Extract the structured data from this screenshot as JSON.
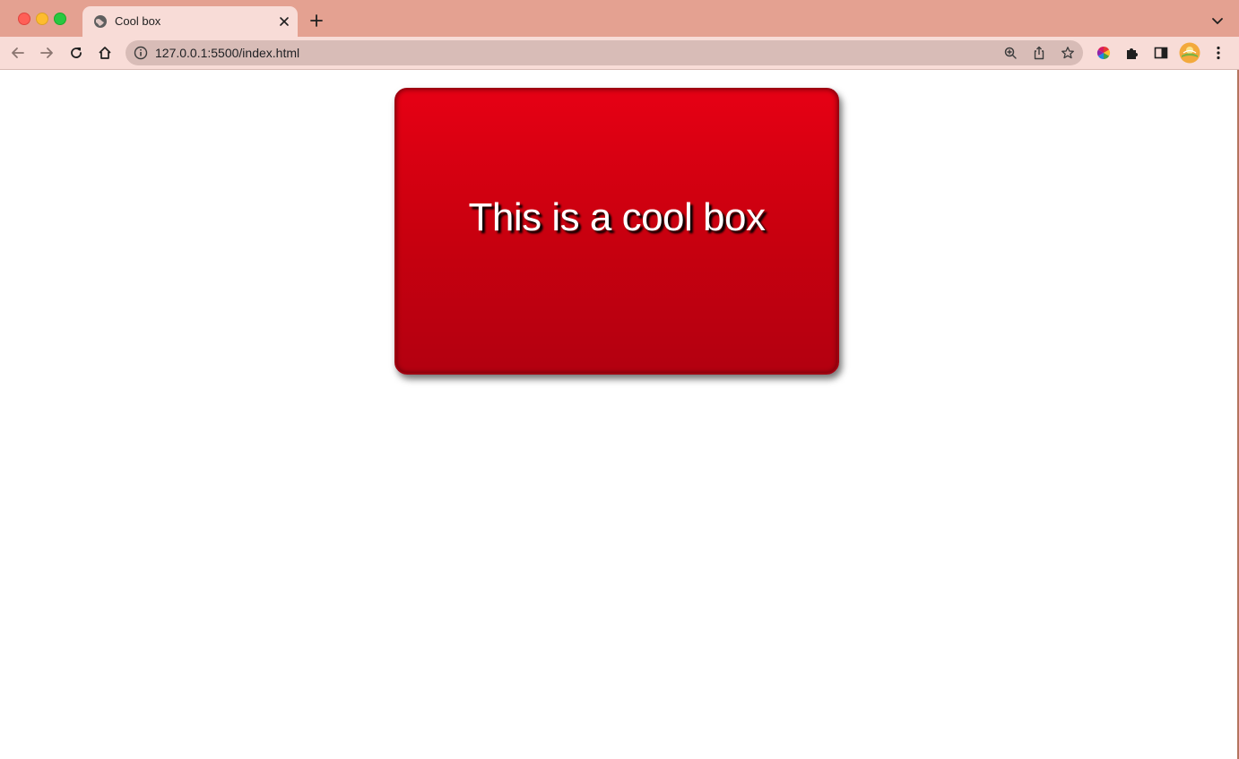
{
  "browser": {
    "tab": {
      "title": "Cool box",
      "favicon": "globe-icon",
      "close_icon": "close-icon"
    },
    "new_tab_icon": "plus-icon",
    "tab_search_icon": "chevron-down-icon",
    "toolbar": {
      "back_icon": "back-arrow-icon",
      "forward_icon": "forward-arrow-icon",
      "reload_icon": "reload-icon",
      "home_icon": "home-icon",
      "address": {
        "url": "127.0.0.1:5500/index.html",
        "info_icon": "info-icon",
        "zoom_icon": "zoom-icon",
        "share_icon": "share-icon",
        "bookmark_icon": "star-icon"
      },
      "extensions": [
        "color-wheel-icon",
        "puzzle-icon",
        "side-panel-icon"
      ],
      "profile_icon": "avatar-icon",
      "menu_icon": "kebab-menu-icon"
    },
    "colors": {
      "frame": "#e4a191",
      "toolbar": "#f8dcd7",
      "omnibox": "#d8bcb7"
    }
  },
  "page": {
    "box_text": "This is a cool box",
    "colors": {
      "box_top": "#e60014",
      "box_bottom": "#b30010",
      "text": "#ffffff",
      "text_shadow": "#000000"
    }
  }
}
